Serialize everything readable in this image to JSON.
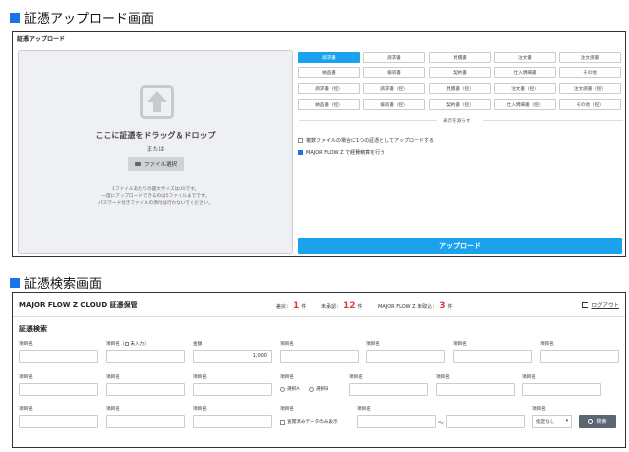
{
  "upload_section": {
    "heading": "証憑アップロード画面",
    "panel_label": "証憑アップロード",
    "drop_text": "ここに証憑をドラッグ＆ドロップ",
    "or_text": "または",
    "file_button": "ファイル選択",
    "notes": [
      "1ファイルあたりの最大サイズは(0)です。",
      "一度にアップロードできるのは5ファイルまでです。",
      "パスワード付きファイルの添付は行わないでください。"
    ],
    "doc_types": [
      [
        "請求書",
        "請求書",
        "見積書",
        "注文書",
        "注文請書"
      ],
      [
        "納品書",
        "検収書",
        "契約書",
        "仕入明細書",
        "その他"
      ],
      [
        "請求書（控）",
        "請求書（控）",
        "見積書（控）",
        "注文書（控）",
        "注文請書（控）"
      ],
      [
        "納品書（控）",
        "検収書（控）",
        "契約書（控）",
        "仕入明細書（控）",
        "その他（控）"
      ]
    ],
    "active_doc": "請求書",
    "show_less": "表示を減らす",
    "option_multiple": "複数ファイルの場合に1つの証憑としてアップロードする",
    "option_multiple_checked": false,
    "option_check": "MAJOR FLOW Z で経費精算を行う",
    "option_check_checked": true,
    "upload_button": "アップロード",
    "accent": "#1aa3ec"
  },
  "search_section": {
    "heading": "証憑検索画面",
    "app_name": "MAJOR FLOW Z CLOUD 証憑保管",
    "stats": [
      {
        "label": "差戻：",
        "value": "1",
        "unit": "件"
      },
      {
        "label": "未承認：",
        "value": "12",
        "unit": "件"
      },
      {
        "label": "MAJOR FLOW Z 未取込：",
        "value": "3",
        "unit": "件"
      }
    ],
    "logout": "ログアウト",
    "title": "証憑検索",
    "row1": [
      {
        "label": "項目名",
        "value": ""
      },
      {
        "label": "項目名（",
        "label_suffix": "未入力）",
        "value": ""
      },
      {
        "label": "金額",
        "value": "1,000"
      },
      {
        "label": "項目名",
        "value": ""
      },
      {
        "label": "項目名",
        "value": ""
      },
      {
        "label": "項目名",
        "value": ""
      },
      {
        "label": "項目名",
        "value": ""
      }
    ],
    "row2_labels": [
      "項目名",
      "項目名",
      "項目名",
      "項目名",
      "項目名",
      "項目名",
      "項目名"
    ],
    "radio_options": [
      "選択A",
      "選択B"
    ],
    "row3_labels": [
      "項目名",
      "項目名",
      "項目名",
      "項目名",
      "項目名",
      "項目名"
    ],
    "checkbox_label": "査閲済みデータのみ表示",
    "tilde": "～",
    "select_value": "指定なし",
    "search_button": "検索"
  }
}
